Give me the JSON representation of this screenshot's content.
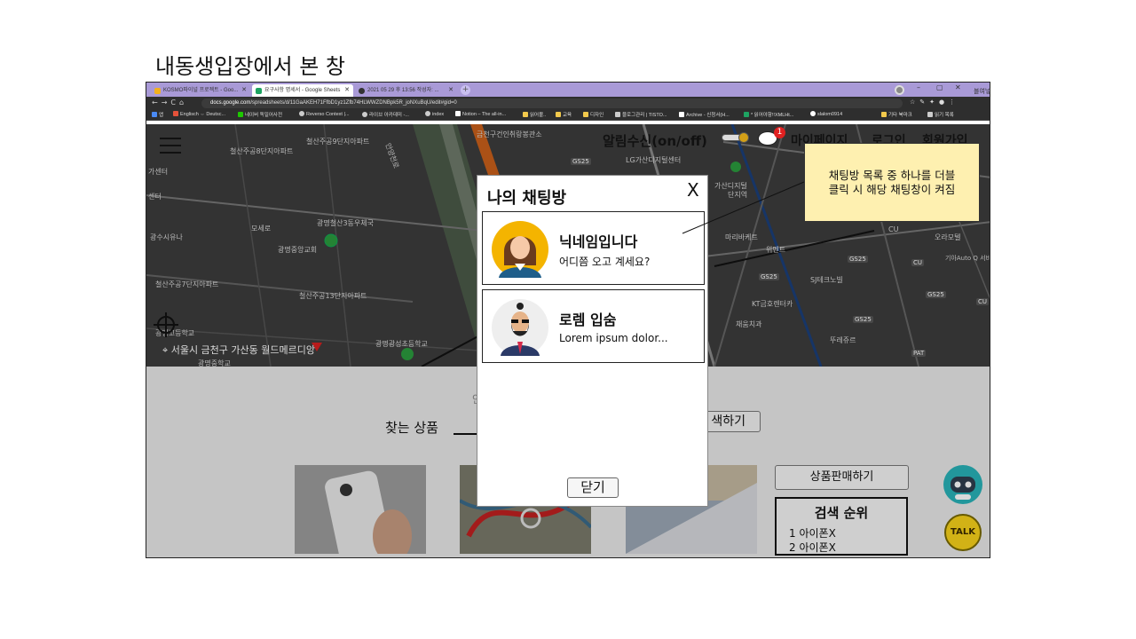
{
  "slide": {
    "title": "내동생입장에서 본 창"
  },
  "browser": {
    "tabs": [
      {
        "label": "KOSMO파이널 프로젝트 - Goo...",
        "color": "#f2b01e"
      },
      {
        "label": "요구사항 명세서 - Google Sheets",
        "color": "#1ea362"
      },
      {
        "label": "2021 05 29 후 13:56 작성자: ...",
        "color": "#333333"
      }
    ],
    "new_tab": "+",
    "window_controls": [
      "–",
      "▢",
      "✕"
    ],
    "url_host": "docs.google.com",
    "url_path": "/spreadsheets/d/11GaAKEH71FfbD1yz1Zfb74HLWWZDNBpk5R_joNXuBqU/edit#gid=0",
    "side_label": "블여넣",
    "bookmarks": [
      {
        "label": "앱",
        "color": "#4a8af4"
      },
      {
        "label": "Englisch ⇔ Deutsc...",
        "color": "#e5523a"
      },
      {
        "label": "네이버 독일어사전",
        "color": "#1ec800"
      },
      {
        "label": "Reverso Context |...",
        "color": "#cccccc"
      },
      {
        "label": "라이브 아카데미 -...",
        "color": "#cccccc"
      },
      {
        "label": "index",
        "color": "#cccccc"
      },
      {
        "label": "Notion – The all-in...",
        "color": "#ffffff"
      },
      {
        "label": "읽어볼..",
        "color": "#f2c94c"
      },
      {
        "label": "교육",
        "color": "#f2c94c"
      },
      {
        "label": "디자인",
        "color": "#f2c94c"
      },
      {
        "label": "블로그관리 | TISTO...",
        "color": "#cccccc"
      },
      {
        "label": "Archive - 신청서(H...",
        "color": "#ffffff"
      },
      {
        "label": "* 읽어야함!!XMLHt...",
        "color": "#1ea362"
      },
      {
        "label": "slalom0914",
        "color": "#ffffff"
      },
      {
        "label": "기타 북마크",
        "color": "#f2c94c"
      },
      {
        "label": "읽기 목록",
        "color": "#cccccc"
      }
    ]
  },
  "header": {
    "notification_toggle_label": "알림수신(on/off)",
    "chat_badge_count": "1",
    "mypage": "마이페이지",
    "login": "로그인",
    "signup": "회원가입"
  },
  "map": {
    "labels": [
      "철산주공9단지아파트",
      "철산주공8단지아파트",
      "안양천로",
      "금천구건인취랑봉관소",
      "GS25",
      "LG가산디지털센터",
      "가산디지털",
      "단지역",
      "마리바케트",
      "가산디지털",
      "위멘트",
      "SJ테크노빌",
      "GS25",
      "CU",
      "오라모텔",
      "모세로",
      "광명철산3동우체국",
      "광명중앙교회",
      "광수시유나",
      "철산주공7단지아파트",
      "철산주공13단지아파트",
      "광명고등학교",
      "광명광성초등학교",
      "광명중학교",
      "가센터",
      "센터",
      "KT금호렌터카",
      "채움치과",
      "뚜레쥬르",
      "PAT",
      "기아Auto Q 서비스 가리봉",
      "GS25",
      "CU",
      "GS25",
      "CU",
      "GS25"
    ],
    "location": "서울시 금천구 가산동 월드메르디앙"
  },
  "main": {
    "hint_text": "안",
    "search_label": "찾는 상품",
    "search_button": "색하기",
    "sell_button": "상품판매하기",
    "ranking_title": "검색 순위",
    "ranking": [
      "1  아이폰X",
      "2  아이폰X"
    ],
    "talk_label": "TALK"
  },
  "modal": {
    "title": "나의 채팅방",
    "close_x": "X",
    "chats": [
      {
        "name": "닉네임입니다",
        "message": "어디쯤 오고 계세요?"
      },
      {
        "name": "로렘 입숨",
        "message": "Lorem ipsum dolor..."
      }
    ],
    "close_button": "닫기"
  },
  "callout": {
    "line1": "채팅방 목록 중 하나를 더블",
    "line2": "클릭 시 해당 채팅창이 켜짐"
  },
  "colors": {
    "tabbar": "#a99ad7",
    "callout_bg": "#fef0b0",
    "map_bg": "#3c3c3c",
    "talk_yellow": "#f7d21a"
  }
}
